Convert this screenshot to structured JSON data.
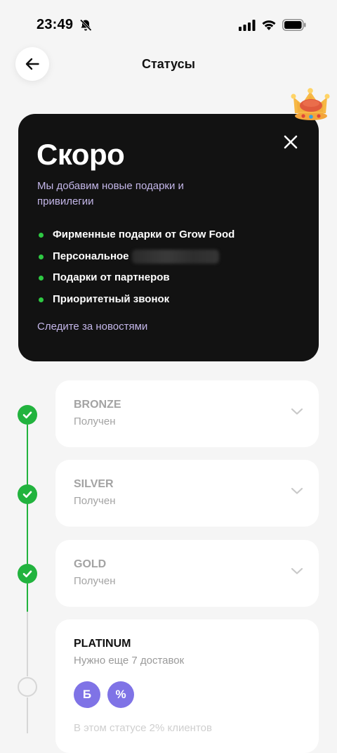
{
  "status_bar": {
    "time": "23:49"
  },
  "header": {
    "title": "Статусы"
  },
  "promo": {
    "title": "Скоро",
    "subtitle": "Мы добавим новые подарки и привилегии",
    "features": [
      "Фирменные подарки от Grow Food",
      "Персональное",
      "Подарки от партнеров",
      "Приоритетный звонок"
    ],
    "footer": "Следите за новостями"
  },
  "statuses": [
    {
      "name": "BRONZE",
      "state": "Получен"
    },
    {
      "name": "SILVER",
      "state": "Получен"
    },
    {
      "name": "GOLD",
      "state": "Получен"
    },
    {
      "name": "PLATINUM",
      "state": "Нужно еще 7 доставок",
      "badges": [
        "Б",
        "%"
      ],
      "note": "В этом статусе 2% клиентов"
    }
  ],
  "colors": {
    "accent_green": "#22b33e",
    "promo_bg": "#121212",
    "promo_muted": "#c3b6e8",
    "badge_purple": "#7f73e6"
  }
}
